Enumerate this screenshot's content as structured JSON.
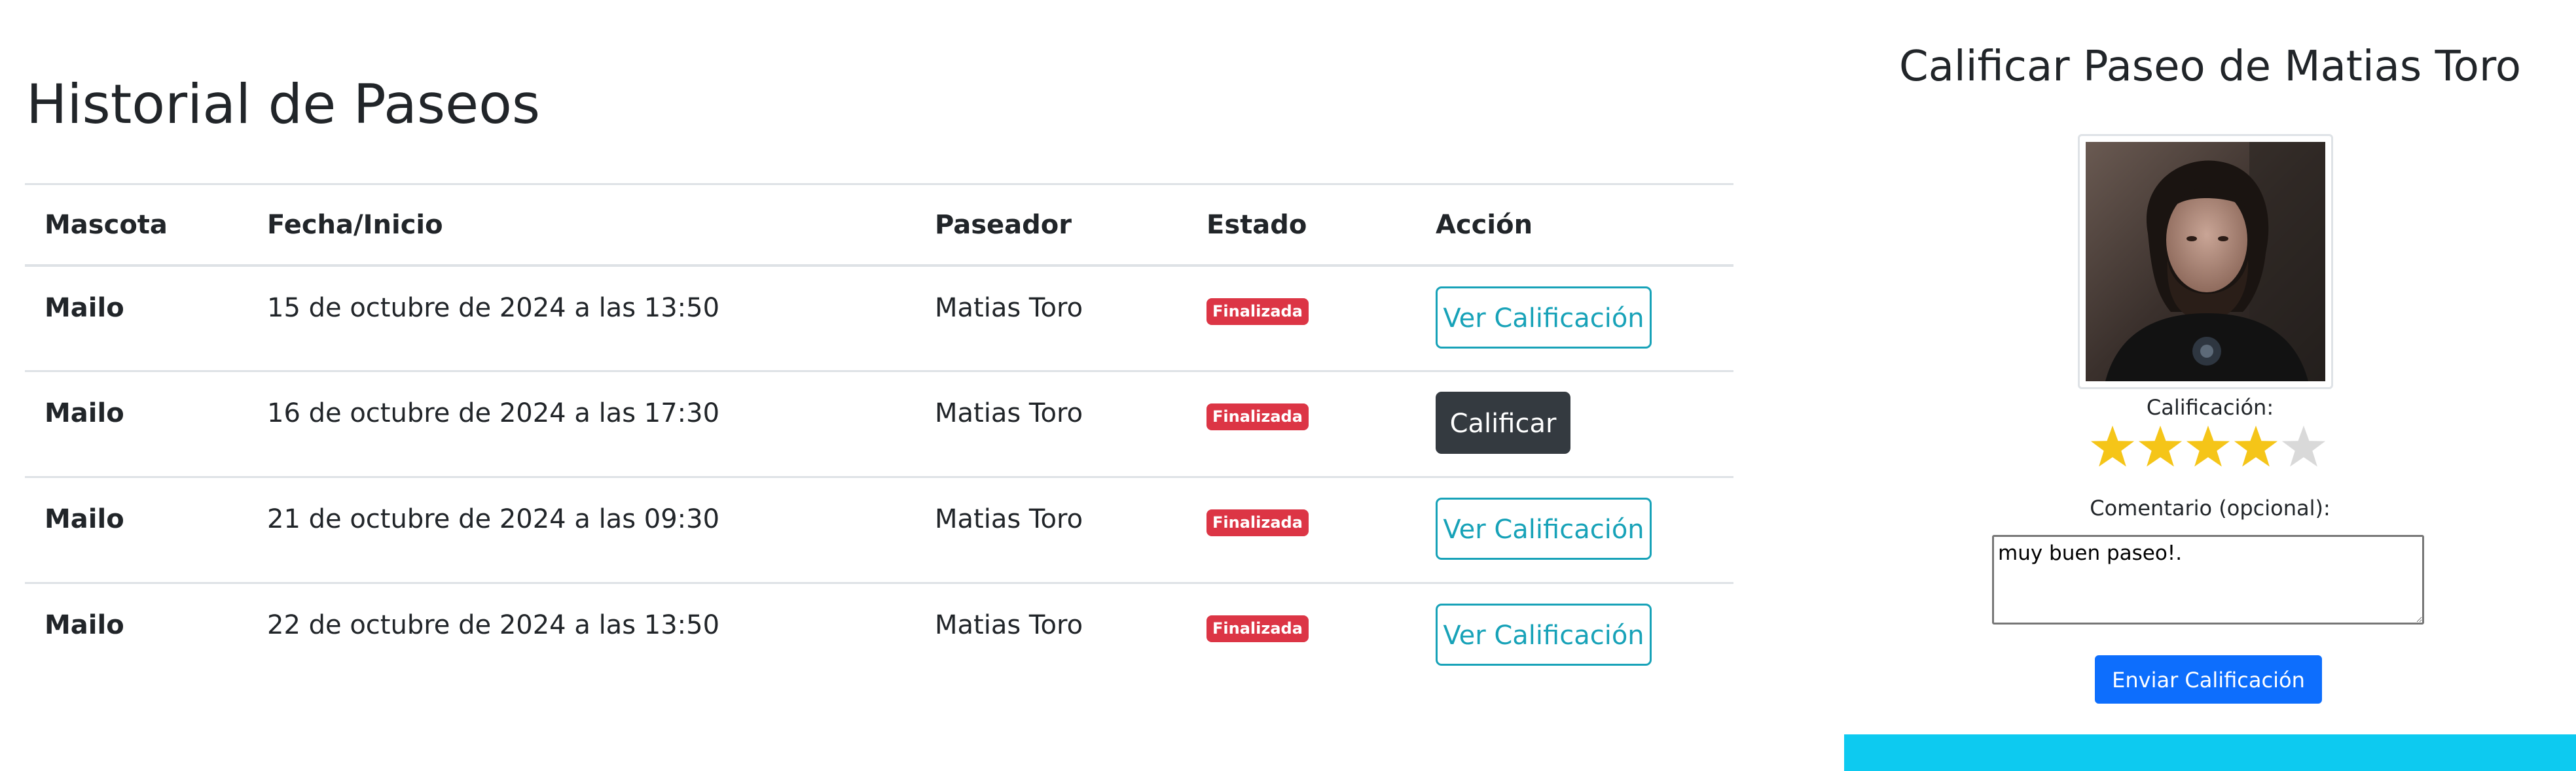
{
  "history": {
    "title": "Historial de Paseos",
    "columns": [
      "Mascota",
      "Fecha/Inicio",
      "Paseador",
      "Estado",
      "Acción"
    ],
    "rows": [
      {
        "pet": "Mailo",
        "date": "15 de octubre de 2024 a las 13:50",
        "walker": "Matias Toro",
        "status": "Finalizada",
        "action": "Ver Calificación"
      },
      {
        "pet": "Mailo",
        "date": "16 de octubre de 2024 a las 17:30",
        "walker": "Matias Toro",
        "status": "Finalizada",
        "action": "Calificar"
      },
      {
        "pet": "Mailo",
        "date": "21 de octubre de 2024 a las 09:30",
        "walker": "Matias Toro",
        "status": "Finalizada",
        "action": "Ver Calificación"
      },
      {
        "pet": "Mailo",
        "date": "22 de octubre de 2024 a las 13:50",
        "walker": "Matias Toro",
        "status": "Finalizada",
        "action": "Ver Calificación"
      }
    ]
  },
  "rating": {
    "title": "Calificar Paseo de Matias Toro",
    "rating_label": "Calificación:",
    "stars_value": 4,
    "stars_max": 5,
    "comment_label": "Comentario (opcional):",
    "comment_value": "muy buen paseo!.",
    "submit_label": "Enviar Calificación"
  },
  "colors": {
    "badge_danger": "#dc3545",
    "outline_info": "#17a2b8",
    "dark_button": "#343a40",
    "primary_button": "#0d6efd",
    "star_filled": "#f5c518",
    "star_empty": "#d9d9d9",
    "footer_bar": "#0dcaf0"
  },
  "icons": {
    "star": "star-icon",
    "profile_photo": "walker-photo"
  }
}
